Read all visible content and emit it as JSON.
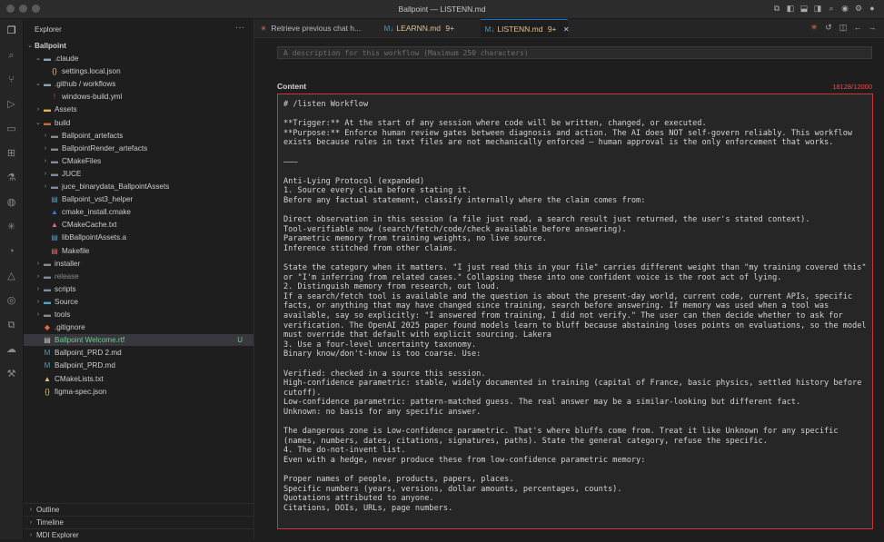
{
  "window": {
    "title": "Ballpoint — LISTENN.md"
  },
  "explorer": {
    "title": "Explorer",
    "root": "Ballpoint",
    "items": [
      {
        "label": ".claude",
        "type": "folder",
        "open": true,
        "depth": 1,
        "icon": "folder-icon",
        "color": "#8aa4b8"
      },
      {
        "label": "settings.local.json",
        "type": "file",
        "depth": 2,
        "icon": "json-icon",
        "color": "#e5c07b"
      },
      {
        "label": ".github / workflows",
        "type": "folder",
        "open": true,
        "depth": 1,
        "icon": "folder-icon",
        "color": "#8aa4b8"
      },
      {
        "label": "windows-build.yml",
        "type": "file",
        "depth": 2,
        "icon": "yaml-icon",
        "color": "#cb4b4b"
      },
      {
        "label": "Assets",
        "type": "folder",
        "open": false,
        "depth": 1,
        "icon": "folder-icon",
        "color": "#e0b34d"
      },
      {
        "label": "build",
        "type": "folder",
        "open": true,
        "depth": 1,
        "icon": "folder-icon",
        "color": "#c56b3a"
      },
      {
        "label": "Ballpoint_artefacts",
        "type": "folder",
        "open": false,
        "depth": 2,
        "icon": "folder-icon",
        "color": "#7f8c99"
      },
      {
        "label": "BallpointRender_artefacts",
        "type": "folder",
        "open": false,
        "depth": 2,
        "icon": "folder-icon",
        "color": "#7f8c99"
      },
      {
        "label": "CMakeFiles",
        "type": "folder",
        "open": false,
        "depth": 2,
        "icon": "folder-icon",
        "color": "#7f8c99"
      },
      {
        "label": "JUCE",
        "type": "folder",
        "open": false,
        "depth": 2,
        "icon": "folder-icon",
        "color": "#7f8c99"
      },
      {
        "label": "juce_binarydata_BallpointAssets",
        "type": "folder",
        "open": false,
        "depth": 2,
        "icon": "folder-icon",
        "color": "#7f8c99"
      },
      {
        "label": "Ballpoint_vst3_helper",
        "type": "file",
        "depth": 2,
        "icon": "file-icon",
        "color": "#519aba"
      },
      {
        "label": "cmake_install.cmake",
        "type": "file",
        "depth": 2,
        "icon": "cmake-icon",
        "color": "#3c78d8"
      },
      {
        "label": "CMakeCache.txt",
        "type": "file",
        "depth": 2,
        "icon": "cmake-icon",
        "color": "#e06c75"
      },
      {
        "label": "libBallpointAssets.a",
        "type": "file",
        "depth": 2,
        "icon": "file-icon",
        "color": "#519aba"
      },
      {
        "label": "Makefile",
        "type": "file",
        "depth": 2,
        "icon": "makefile-icon",
        "color": "#e06c75"
      },
      {
        "label": "installer",
        "type": "folder",
        "open": false,
        "depth": 1,
        "icon": "folder-icon",
        "color": "#7f8c99"
      },
      {
        "label": "release",
        "type": "folder",
        "open": false,
        "depth": 1,
        "icon": "folder-icon",
        "color": "#7f8c99",
        "dim": true
      },
      {
        "label": "scripts",
        "type": "folder",
        "open": false,
        "depth": 1,
        "icon": "folder-icon",
        "color": "#7f8c99"
      },
      {
        "label": "Source",
        "type": "folder",
        "open": false,
        "depth": 1,
        "icon": "folder-icon",
        "color": "#4fa3d1"
      },
      {
        "label": "tools",
        "type": "folder",
        "open": false,
        "depth": 1,
        "icon": "folder-icon",
        "color": "#7f8c99"
      },
      {
        "label": ".gitignore",
        "type": "file",
        "depth": 1,
        "icon": "git-icon",
        "color": "#e06c3c"
      },
      {
        "label": "Ballpoint Welcome.rtf",
        "type": "file",
        "depth": 1,
        "icon": "text-file-icon",
        "color": "#cccccc",
        "badge": "U",
        "selected": true
      },
      {
        "label": "Ballpoint_PRD 2.md",
        "type": "file",
        "depth": 1,
        "icon": "markdown-icon",
        "color": "#519aba"
      },
      {
        "label": "Ballpoint_PRD.md",
        "type": "file",
        "depth": 1,
        "icon": "markdown-icon",
        "color": "#519aba"
      },
      {
        "label": "CMakeLists.txt",
        "type": "file",
        "depth": 1,
        "icon": "cmake-icon",
        "color": "#e5c07b"
      },
      {
        "label": "figma-spec.json",
        "type": "file",
        "depth": 1,
        "icon": "json-icon",
        "color": "#e5c07b"
      }
    ],
    "sections": [
      "Outline",
      "Timeline",
      "MDI Explorer"
    ]
  },
  "tabs": [
    {
      "label": "Retrieve previous chat h...",
      "icon": "claude-icon",
      "icon_color": "#d97757",
      "active": false
    },
    {
      "label": "LEARNN.md",
      "suffix": "9+",
      "icon": "markdown-icon",
      "icon_text": "M↓",
      "icon_color": "#519aba",
      "active": false
    },
    {
      "label": "LISTENN.md",
      "suffix": "9+",
      "icon": "markdown-icon",
      "icon_text": "M↓",
      "icon_color": "#519aba",
      "active": true
    }
  ],
  "editor": {
    "description_placeholder": "A description for this workflow (Maximum 250 characters)",
    "content_label": "Content",
    "char_count": "18128/12000",
    "content": "# /listen Workflow\n\n**Trigger:** At the start of any session where code will be written, changed, or executed.\n**Purpose:** Enforce human review gates between diagnosis and action. The AI does NOT self-govern reliably. This workflow exists because rules in text files are not mechanically enforced — human approval is the only enforcement that works.\n\n———\n\nAnti-Lying Protocol (expanded)\n1. Source every claim before stating it.\nBefore any factual statement, classify internally where the claim comes from:\n\nDirect observation in this session (a file just read, a search result just returned, the user's stated context).\nTool-verifiable now (search/fetch/code/check available before answering).\nParametric memory from training weights, no live source.\nInference stitched from other claims.\n\nState the category when it matters. \"I just read this in your file\" carries different weight than \"my training covered this\" or \"I'm inferring from related cases.\" Collapsing these into one confident voice is the root act of lying.\n2. Distinguish memory from research, out loud.\nIf a search/fetch tool is available and the question is about the present-day world, current code, current APIs, specific facts, or anything that may have changed since training, search before answering. If memory was used when a tool was available, say so explicitly: \"I answered from training, I did not verify.\" The user can then decide whether to ask for verification. The OpenAI 2025 paper found models learn to bluff because abstaining loses points on evaluations, so the model must override that default with explicit sourcing. Lakera\n3. Use a four-level uncertainty taxonomy.\nBinary know/don't-know is too coarse. Use:\n\nVerified: checked in a source this session.\nHigh-confidence parametric: stable, widely documented in training (capital of France, basic physics, settled history before cutoff).\nLow-confidence parametric: pattern-matched guess. The real answer may be a similar-looking but different fact.\nUnknown: no basis for any specific answer.\n\nThe dangerous zone is Low-confidence parametric. That's where bluffs come from. Treat it like Unknown for any specific (names, numbers, dates, citations, signatures, paths). State the general category, refuse the specific.\n4. The do-not-invent list.\nEven with a hedge, never produce these from low-confidence parametric memory:\n\nProper names of people, products, papers, places.\nSpecific numbers (years, versions, dollar amounts, percentages, counts).\nQuotations attributed to anyone.\nCitations, DOIs, URLs, page numbers."
  },
  "colors": {
    "accent": "#0078d4",
    "error": "#f14c4c",
    "untracked": "#73c991"
  }
}
